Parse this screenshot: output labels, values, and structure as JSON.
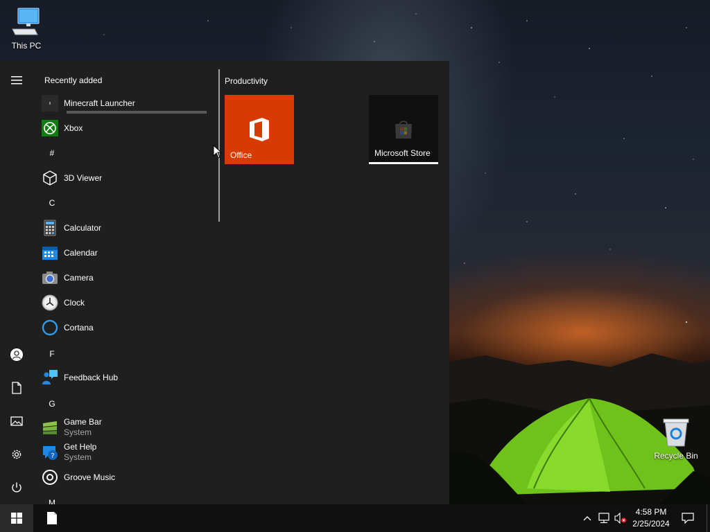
{
  "desktop": {
    "icons": [
      {
        "label": "This PC",
        "icon": "computer-icon"
      },
      {
        "label": "Recycle Bin",
        "icon": "recycle-bin-icon"
      }
    ]
  },
  "start_menu": {
    "rail": {
      "items": [
        {
          "name": "menu",
          "icon": "hamburger-icon"
        },
        {
          "name": "account",
          "icon": "user-icon"
        },
        {
          "name": "documents",
          "icon": "document-icon"
        },
        {
          "name": "pictures",
          "icon": "pictures-icon"
        },
        {
          "name": "settings",
          "icon": "gear-icon"
        },
        {
          "name": "power",
          "icon": "power-icon"
        }
      ]
    },
    "recently_added_title": "Recently added",
    "apps": {
      "minecraft": "Minecraft Launcher",
      "xbox": "Xbox",
      "hash_group": "#",
      "viewer3d": "3D Viewer",
      "c_group": "C",
      "calculator": "Calculator",
      "calendar": "Calendar",
      "camera": "Camera",
      "clock": "Clock",
      "cortana": "Cortana",
      "f_group": "F",
      "feedback": "Feedback Hub",
      "g_group": "G",
      "gamebar": "Game Bar",
      "gamebar_sub": "System",
      "gethelp": "Get Help",
      "gethelp_sub": "System",
      "groove": "Groove Music",
      "m_group": "M"
    },
    "tiles": {
      "group_title": "Productivity",
      "office": "Office",
      "store": "Microsoft Store"
    }
  },
  "taskbar": {
    "time": "4:58 PM",
    "date": "2/25/2024"
  },
  "colors": {
    "office_tile": "#d83b01",
    "store_tile": "#101010",
    "xbox_green": "#107c10",
    "accent_blue": "#0078d4"
  }
}
